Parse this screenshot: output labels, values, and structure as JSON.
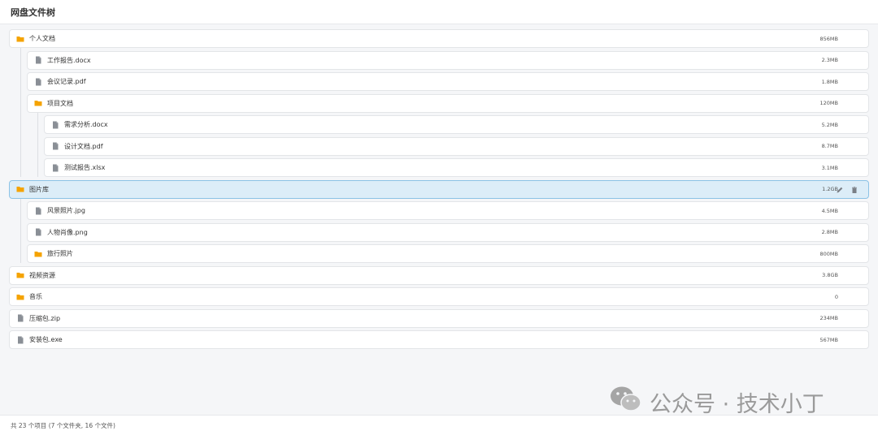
{
  "header": {
    "title": "网盘文件树"
  },
  "colors": {
    "folder": "#f5a300",
    "file": "#8a8f96",
    "selected_bg": "#dcedf8",
    "selected_border": "#8cc3e6"
  },
  "tree": {
    "personal_docs": {
      "name": "个人文档",
      "size": "856MB",
      "icon": "folder-icon"
    },
    "work_report": {
      "name": "工作报告.docx",
      "size": "2.3MB",
      "icon": "file-icon"
    },
    "meeting_notes": {
      "name": "会议记录.pdf",
      "size": "1.8MB",
      "icon": "file-icon"
    },
    "project_docs": {
      "name": "项目文档",
      "size": "120MB",
      "icon": "folder-icon"
    },
    "requirements": {
      "name": "需求分析.docx",
      "size": "5.2MB",
      "icon": "file-icon"
    },
    "design_doc": {
      "name": "设计文档.pdf",
      "size": "8.7MB",
      "icon": "file-icon"
    },
    "test_report": {
      "name": "测试报告.xlsx",
      "size": "3.1MB",
      "icon": "file-icon"
    },
    "pictures": {
      "name": "图片库",
      "size": "1.2GB",
      "icon": "folder-icon",
      "selected": true
    },
    "landscape": {
      "name": "风景照片.jpg",
      "size": "4.5MB",
      "icon": "file-icon"
    },
    "portrait": {
      "name": "人物肖像.png",
      "size": "2.8MB",
      "icon": "file-icon"
    },
    "travel": {
      "name": "旅行照片",
      "size": "800MB",
      "icon": "folder-icon"
    },
    "videos": {
      "name": "视频资源",
      "size": "3.8GB",
      "icon": "folder-icon"
    },
    "music": {
      "name": "音乐",
      "size": "0",
      "icon": "folder-icon"
    },
    "archive": {
      "name": "压缩包.zip",
      "size": "234MB",
      "icon": "file-icon"
    },
    "installer": {
      "name": "安装包.exe",
      "size": "567MB",
      "icon": "file-icon"
    }
  },
  "watermark": {
    "text": "公众号 · 技术小丁",
    "icon": "wechat-icon"
  },
  "footer": {
    "summary": "共 23 个项目 (7 个文件夹, 16 个文件)"
  }
}
